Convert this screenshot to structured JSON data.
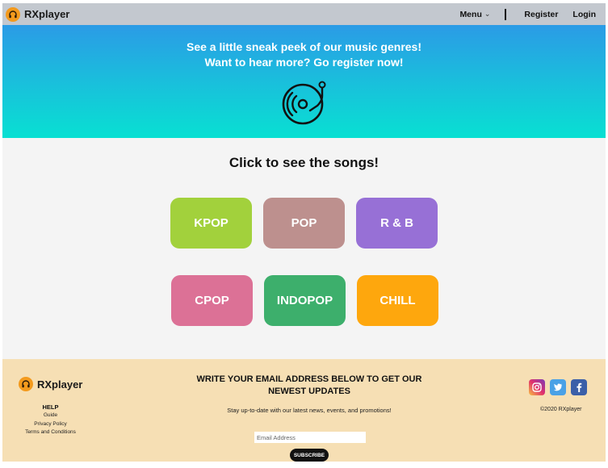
{
  "nav": {
    "brand": "RXplayer",
    "menu_label": "Menu",
    "register_label": "Register",
    "login_label": "Login"
  },
  "hero": {
    "line1": "See a little sneak peek of our music genres!",
    "line2": "Want to hear more? Go register now!",
    "icon": "turntable-icon"
  },
  "main": {
    "title": "Click to see the songs!",
    "genres": [
      {
        "label": "KPOP",
        "color": "#a2d13c"
      },
      {
        "label": "POP",
        "color": "#bd908e"
      },
      {
        "label": "R & B",
        "color": "#9770d6"
      },
      {
        "label": "CPOP",
        "color": "#dc7196"
      },
      {
        "label": "INDOPOP",
        "color": "#3daf6c"
      },
      {
        "label": "CHILL",
        "color": "#fea70d"
      }
    ]
  },
  "footer": {
    "brand": "RXplayer",
    "help_title": "HELP",
    "links": [
      "Guide",
      "Privacy Policy",
      "Terms and Conditions"
    ],
    "heading": "WRITE YOUR EMAIL ADDRESS BELOW TO GET OUR NEWEST UPDATES",
    "subtext": "Stay up-to-date with our latest news, events, and promotions!",
    "email_placeholder": "Email Address",
    "subscribe_label": "SUBSCRIBE",
    "social_icons": [
      "instagram-icon",
      "twitter-icon",
      "facebook-icon"
    ],
    "copyright": "©2020 RXplayer"
  },
  "colors": {
    "nav_bg": "#c3c8cf",
    "logo": "#f39a1d",
    "hero_top": "#2b9be6",
    "hero_bottom": "#08e0d2",
    "footer_bg": "#f6dfb4"
  }
}
